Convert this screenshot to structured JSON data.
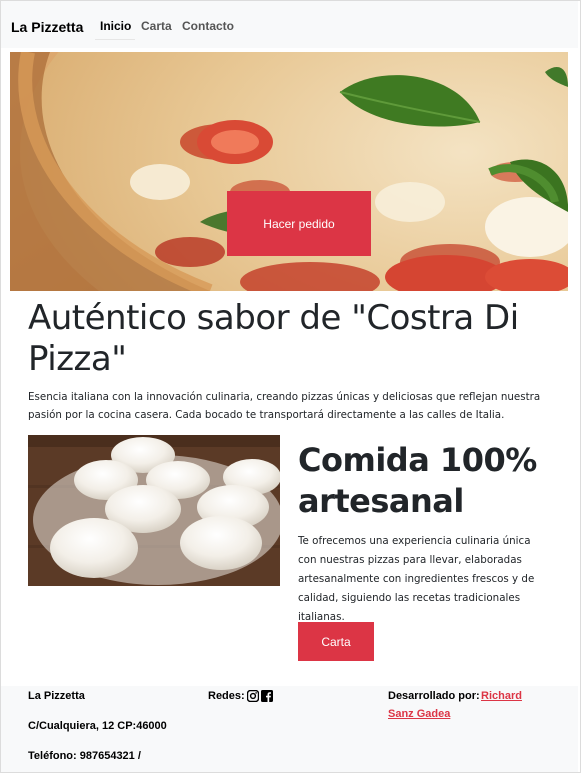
{
  "navbar": {
    "brand": "La Pizzetta",
    "links": [
      {
        "label": "Inicio",
        "active": true
      },
      {
        "label": "Carta",
        "active": false
      },
      {
        "label": "Contacto",
        "active": false
      }
    ]
  },
  "hero": {
    "button_label": "Hacer pedido"
  },
  "main": {
    "title": "Auténtico sabor de \"Costra Di Pizza\"",
    "description": "Esencia italiana con la innovación culinaria, creando pizzas únicas y deliciosas que reflejan nuestra pasión por la cocina casera. Cada bocado te transportará directamente a las calles de Italia."
  },
  "feature": {
    "title": "Comida 100% artesanal",
    "description": "Te ofrecemos una experiencia culinaria única con nuestras pizzas para llevar, elaboradas artesanalmente con ingredientes frescos y de calidad, siguiendo las recetas tradicionales italianas.",
    "button_label": "Carta"
  },
  "footer": {
    "brand": "La Pizzetta",
    "address": "C/Cualquiera, 12 CP:46000",
    "phone": "Teléfono: 987654321 /",
    "social_label": "Redes:",
    "social_icons": [
      "instagram-icon",
      "facebook-icon"
    ],
    "dev_label": "Desarrollado por:",
    "dev_name_line1": "Richard",
    "dev_name_line2": "Sanz Gadea"
  },
  "colors": {
    "accent": "#dc3545",
    "navbar_bg": "#f8f9fa",
    "text": "#212529"
  }
}
